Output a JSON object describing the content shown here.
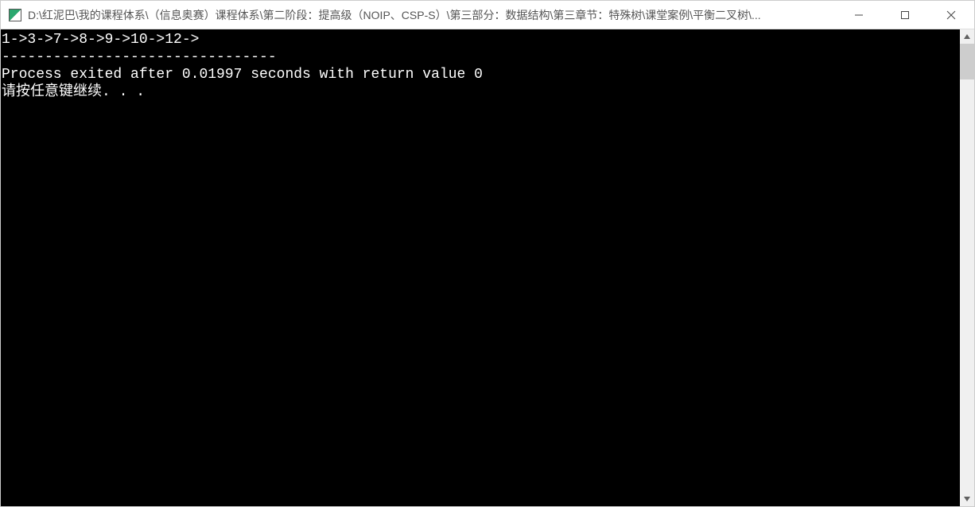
{
  "window": {
    "title": "D:\\红泥巴\\我的课程体系\\（信息奥赛）课程体系\\第二阶段：提高级（NOIP、CSP-S）\\第三部分：数据结构\\第三章节：特殊树\\课堂案例\\平衡二叉树\\..."
  },
  "console": {
    "line1": "1->3->7->8->9->10->12->",
    "line2": "--------------------------------",
    "line3": "Process exited after 0.01997 seconds with return value 0",
    "line4": "请按任意键继续. . ."
  }
}
